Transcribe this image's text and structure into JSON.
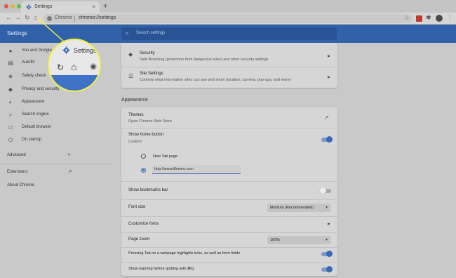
{
  "browser": {
    "tab_title": "Settings",
    "tab_close": "×",
    "new_tab": "+",
    "omnibox_chip": "Chrome",
    "omnibox_url": "chrome://settings",
    "icons": [
      "back-icon",
      "forward-icon",
      "reload-icon",
      "home-icon",
      "star-icon",
      "extension-icon",
      "puzzle-icon",
      "avatar-icon",
      "menu-icon"
    ]
  },
  "header": {
    "title": "Settings",
    "search_placeholder": "Search settings",
    "accent": "#3161a8"
  },
  "sidebar": {
    "items": [
      {
        "label": "You and Google",
        "icon": "person-icon"
      },
      {
        "label": "Autofill",
        "icon": "clipboard-icon"
      },
      {
        "label": "Safety check",
        "icon": "shield-check-icon"
      },
      {
        "label": "Privacy and security",
        "icon": "shield-icon"
      },
      {
        "label": "Appearance",
        "icon": "palette-icon"
      },
      {
        "label": "Search engine",
        "icon": "search-icon"
      },
      {
        "label": "Default browser",
        "icon": "browser-icon"
      },
      {
        "label": "On startup",
        "icon": "power-icon"
      }
    ],
    "advanced": "Advanced",
    "extensions": "Extensions",
    "about": "About Chrome"
  },
  "callout": {
    "title": "Settings"
  },
  "privacy_card": {
    "security_title": "Security",
    "security_desc": "Safe Browsing (protection from dangerous sites) and other security settings",
    "site_title": "Site Settings",
    "site_desc": "Controls what information sites can use and show (location, camera, pop-ups, and more)"
  },
  "appearance": {
    "section_title": "Appearance",
    "themes_title": "Themes",
    "themes_desc": "Open Chrome Web Store",
    "home_title": "Show home button",
    "home_desc": "Custom",
    "home_enabled": true,
    "radio_newtab": "New Tab page",
    "radio_custom_selected": true,
    "custom_url": "http://www.lifewire.com",
    "bookmarks_title": "Show bookmarks bar",
    "bookmarks_enabled": false,
    "font_size_label": "Font size",
    "font_size_value": "Medium (Recommended)",
    "customize_fonts": "Customize fonts",
    "page_zoom_label": "Page zoom",
    "page_zoom_value": "100%",
    "tab_highlight": "Pressing Tab on a webpage highlights links, as well as form fields",
    "tab_highlight_enabled": true,
    "quit_warning": "Show warning before quitting with ⌘Q",
    "quit_warning_enabled": true
  }
}
